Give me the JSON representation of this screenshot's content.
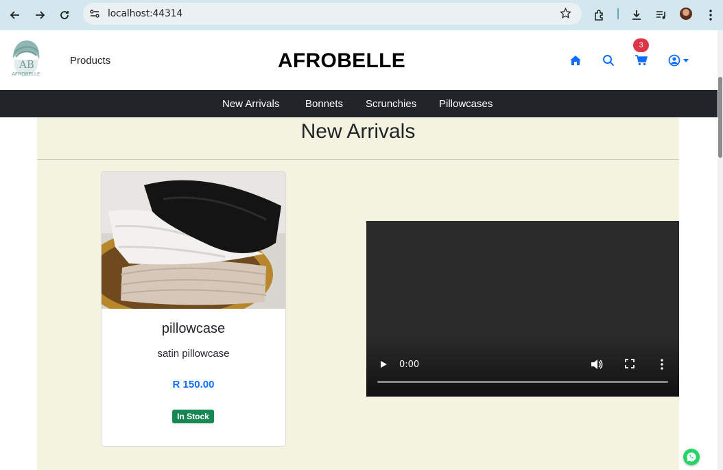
{
  "browser": {
    "url": "localhost:44314"
  },
  "header": {
    "logo_text": "AB",
    "logo_sub": "AFROBELLE",
    "products_link": "Products",
    "brand": "AFROBELLE",
    "cart_count": "3"
  },
  "nav": {
    "items": [
      {
        "label": "New Arrivals"
      },
      {
        "label": "Bonnets"
      },
      {
        "label": "Scrunchies"
      },
      {
        "label": "Pillowcases"
      }
    ]
  },
  "main": {
    "title": "New Arrivals",
    "product": {
      "name": "pillowcase",
      "description": "satin pillowcase",
      "price": "R 150.00",
      "stock": "In Stock"
    },
    "video": {
      "time": "0:00"
    }
  },
  "colors": {
    "accent": "#0d6efd",
    "nav_bg": "#212529",
    "badge_red": "#dc3545",
    "stock_green": "#198754",
    "section_bg": "#f3f3df"
  }
}
